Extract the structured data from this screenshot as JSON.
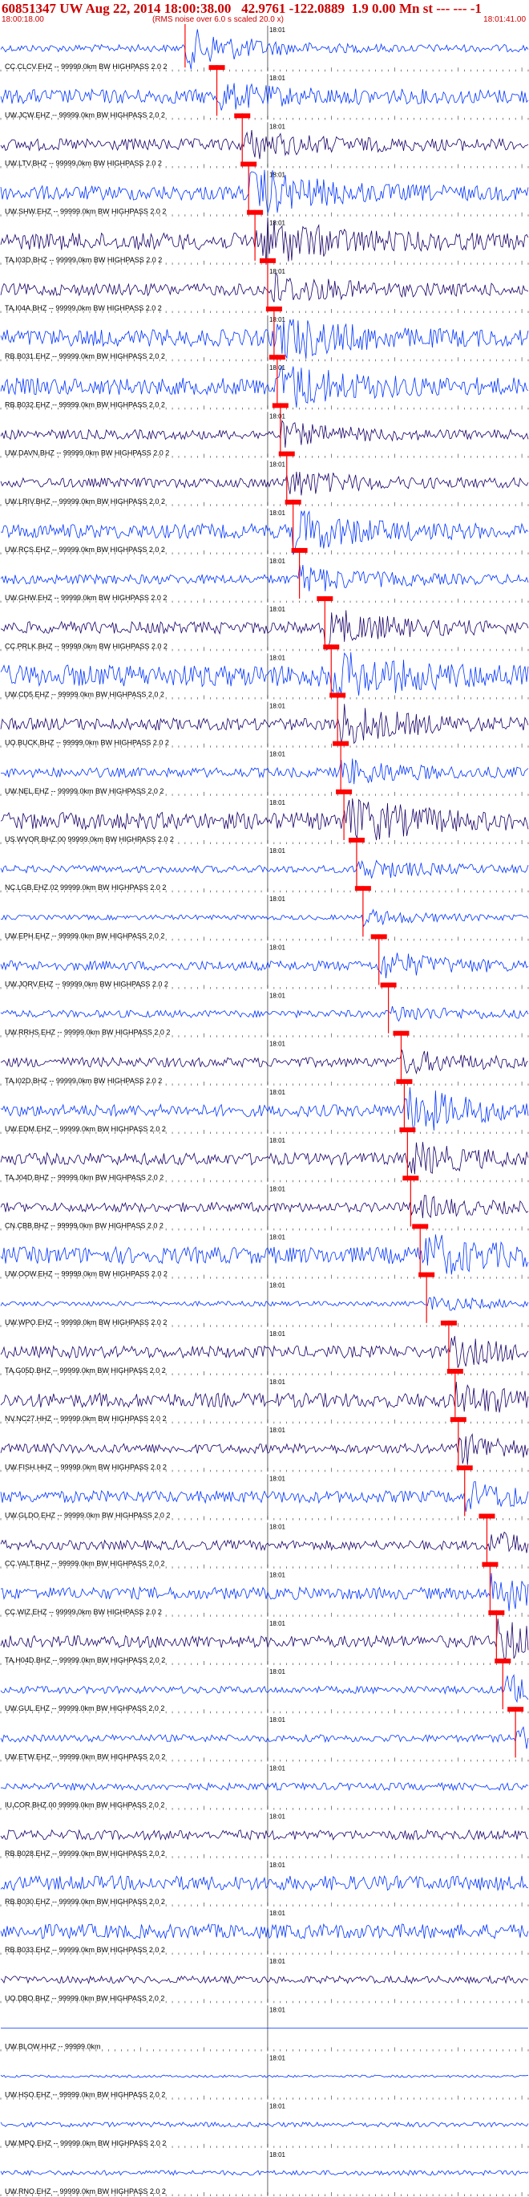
{
  "header": {
    "event_line": "60851347 UW Aug 22, 2014 18:00:38.00   42.9761 -122.0889  1.9 0.00 Mn st --- --- -1",
    "start_time": "18:00:18.00",
    "rms_note": "(RMS noise over 6.0 s scaled 20.0 x)",
    "end_time": "18:01:41.00"
  },
  "chart_data": {
    "type": "seismogram-record-section",
    "time_start": "18:00:18.00",
    "time_end": "18:01:41.00",
    "minute_mark": "18:01",
    "colors": {
      "trace_a": "#0033ff",
      "trace_b": "#1a0066",
      "pick": "#ff0000",
      "text": "#000000"
    },
    "traces": [
      {
        "label": "CC.CLCV.EHZ -- 99999.0km BW  HIGHPASS  2.0  2",
        "pick_s": 29.0,
        "amp": 0.15,
        "event_amp": 0.8,
        "color": "blue"
      },
      {
        "label": "UW.JCW.EHZ -- 99999.0km BW  HIGHPASS  2.0  2",
        "pick_s": 34.0,
        "amp": 0.3,
        "event_amp": 0.4,
        "color": "blue"
      },
      {
        "label": "UW.LTV.BHZ -- 99999.0km BW  HIGHPASS  2.0  2",
        "pick_s": 38.0,
        "amp": 0.25,
        "event_amp": 0.5,
        "color": "dark"
      },
      {
        "label": "UW.SHW.EHZ -- 99999.0km BW  HIGHPASS  2.0  2",
        "pick_s": 39.0,
        "amp": 0.3,
        "event_amp": 1.0,
        "color": "blue"
      },
      {
        "label": "TA.I03D.BHZ -- 99999.0km BW  HIGHPASS  2.0  2",
        "pick_s": 40.0,
        "amp": 0.35,
        "event_amp": 1.0,
        "color": "dark"
      },
      {
        "label": "TA.I04A.BHZ -- 99999.0km BW  HIGHPASS  2.0  2",
        "pick_s": 42.0,
        "amp": 0.25,
        "event_amp": 0.6,
        "color": "dark"
      },
      {
        "label": "RB.B031.EHZ -- 99999.0km BW  HIGHPASS  2.0  2",
        "pick_s": 43.0,
        "amp": 0.35,
        "event_amp": 0.9,
        "color": "blue"
      },
      {
        "label": "RB.B032.EHZ -- 99999.0km BW  HIGHPASS  2.0  2",
        "pick_s": 43.5,
        "amp": 0.35,
        "event_amp": 0.9,
        "color": "blue"
      },
      {
        "label": "UW.DAVN.BHZ -- 99999.0km BW  HIGHPASS  2.0  2",
        "pick_s": 44.0,
        "amp": 0.2,
        "event_amp": 0.4,
        "color": "dark"
      },
      {
        "label": "UW.LRIV.BHZ -- 99999.0km BW  HIGHPASS  2.0  2",
        "pick_s": 45.0,
        "amp": 0.2,
        "event_amp": 0.5,
        "color": "dark"
      },
      {
        "label": "UW.RCS.EHZ -- 99999.0km BW  HIGHPASS  2.0  2",
        "pick_s": 46.0,
        "amp": 0.3,
        "event_amp": 0.8,
        "color": "blue"
      },
      {
        "label": "UW.GHW.EHZ -- 99999.0km BW  HIGHPASS  2.0  2",
        "pick_s": 47.0,
        "amp": 0.2,
        "event_amp": 0.5,
        "color": "blue"
      },
      {
        "label": "CC.PRLK.BHZ -- 99999.0km BW  HIGHPASS  2.0  2",
        "pick_s": 51.0,
        "amp": 0.25,
        "event_amp": 0.7,
        "color": "dark"
      },
      {
        "label": "UW.CD5.EHZ -- 99999.0km BW  HIGHPASS  2.0  2",
        "pick_s": 52.0,
        "amp": 0.45,
        "event_amp": 0.8,
        "color": "blue"
      },
      {
        "label": "UO.BUCK.BHZ -- 99999.0km BW  HIGHPASS  2.0  2",
        "pick_s": 53.0,
        "amp": 0.25,
        "event_amp": 0.8,
        "color": "dark"
      },
      {
        "label": "UW.NEL.EHZ -- 99999.0km BW  HIGHPASS  2.0  2",
        "pick_s": 53.5,
        "amp": 0.2,
        "event_amp": 0.5,
        "color": "blue"
      },
      {
        "label": "US.WVOR.BHZ.00 99999.0km BW  HIGHPASS  2.0  2",
        "pick_s": 54.0,
        "amp": 0.35,
        "event_amp": 0.9,
        "color": "dark"
      },
      {
        "label": "NC.LGB.EHZ.02 99999.0km BW  HIGHPASS  2.0  2",
        "pick_s": 56.0,
        "amp": 0.15,
        "event_amp": 0.4,
        "color": "blue"
      },
      {
        "label": "UW.EPH.EHZ -- 99999.0km BW  HIGHPASS  2.0  2",
        "pick_s": 57.0,
        "amp": 0.1,
        "event_amp": 0.3,
        "color": "blue"
      },
      {
        "label": "UW.JORV.EHZ -- 99999.0km BW  HIGHPASS  2.0  2",
        "pick_s": 59.5,
        "amp": 0.2,
        "event_amp": 0.5,
        "color": "blue"
      },
      {
        "label": "UW.RRHS.EHZ -- 99999.0km BW  HIGHPASS  2.0  2",
        "pick_s": 61.0,
        "amp": 0.15,
        "event_amp": 0.3,
        "color": "blue"
      },
      {
        "label": "TA.I02D.BHZ -- 99999.0km BW  HIGHPASS  2.0  2",
        "pick_s": 63.0,
        "amp": 0.2,
        "event_amp": 0.4,
        "color": "dark"
      },
      {
        "label": "UW.EDM.EHZ -- 99999.0km BW  HIGHPASS  2.0  2",
        "pick_s": 63.5,
        "amp": 0.25,
        "event_amp": 1.0,
        "color": "blue"
      },
      {
        "label": "TA.J04D.BHZ -- 99999.0km BW  HIGHPASS  2.0  2",
        "pick_s": 64.0,
        "amp": 0.25,
        "event_amp": 0.6,
        "color": "dark"
      },
      {
        "label": "CN.CBB.BHZ -- 99999.0km BW  HIGHPASS  2.0  2",
        "pick_s": 64.5,
        "amp": 0.2,
        "event_amp": 0.4,
        "color": "dark"
      },
      {
        "label": "UW.OOW.EHZ -- 99999.0km BW  HIGHPASS  2.0  2",
        "pick_s": 66.0,
        "amp": 0.35,
        "event_amp": 0.8,
        "color": "blue"
      },
      {
        "label": "UW.WPO.EHZ -- 99999.0km BW  HIGHPASS  2.0  2",
        "pick_s": 67.0,
        "amp": 0.1,
        "event_amp": 0.3,
        "color": "blue"
      },
      {
        "label": "TA.G05D.BHZ -- 99999.0km BW  HIGHPASS  2.0  2",
        "pick_s": 70.5,
        "amp": 0.25,
        "event_amp": 0.5,
        "color": "dark"
      },
      {
        "label": "NV.NC27.HHZ -- 99999.0km BW  HIGHPASS  2.0  2",
        "pick_s": 71.5,
        "amp": 0.3,
        "event_amp": 0.5,
        "color": "dark"
      },
      {
        "label": "UW.FISH.HHZ -- 99999.0km BW  HIGHPASS  2.0  2",
        "pick_s": 72.0,
        "amp": 0.2,
        "event_amp": 0.6,
        "color": "dark"
      },
      {
        "label": "UW.GLDO.EHZ -- 99999.0km BW  HIGHPASS  2.0  2",
        "pick_s": 73.0,
        "amp": 0.25,
        "event_amp": 0.5,
        "color": "blue"
      },
      {
        "label": "CC.VALT.BHZ -- 99999.0km BW  HIGHPASS  2.0  2",
        "pick_s": 76.5,
        "amp": 0.2,
        "event_amp": 0.5,
        "color": "dark"
      },
      {
        "label": "CC.WIZ.EHZ -- 99999.0km BW  HIGHPASS  2.0  2",
        "pick_s": 77.0,
        "amp": 0.25,
        "event_amp": 0.7,
        "color": "blue"
      },
      {
        "label": "TA.H04D.BHZ -- 99999.0km BW  HIGHPASS  2.0  2",
        "pick_s": 78.0,
        "amp": 0.25,
        "event_amp": 0.8,
        "color": "dark"
      },
      {
        "label": "UW.GUL.EHZ -- 99999.0km BW  HIGHPASS  2.0  2",
        "pick_s": 79.0,
        "amp": 0.15,
        "event_amp": 0.6,
        "color": "blue"
      },
      {
        "label": "UW.ETW.EHZ -- 99999.0km BW  HIGHPASS  2.0  2",
        "pick_s": 81.0,
        "amp": 0.15,
        "event_amp": 0.4,
        "color": "blue"
      },
      {
        "label": "IU.COR.BHZ.00 99999.0km BW  HIGHPASS  2.0  2",
        "pick_s": null,
        "amp": 0.15,
        "event_amp": 0.0,
        "color": "blue"
      },
      {
        "label": "RB.B028.EHZ -- 99999.0km BW  HIGHPASS  2.0  2",
        "pick_s": null,
        "amp": 0.2,
        "event_amp": 0.0,
        "color": "dark"
      },
      {
        "label": "RB.B030.EHZ -- 99999.0km BW  HIGHPASS  2.0  2",
        "pick_s": null,
        "amp": 0.3,
        "event_amp": 0.0,
        "color": "blue"
      },
      {
        "label": "RB.B033.EHZ -- 99999.0km BW  HIGHPASS  2.0  2",
        "pick_s": null,
        "amp": 0.3,
        "event_amp": 0.0,
        "color": "blue"
      },
      {
        "label": "UO.DBO.BHZ -- 99999.0km BW  HIGHPASS  2.0  2",
        "pick_s": null,
        "amp": 0.15,
        "event_amp": 0.0,
        "color": "dark"
      },
      {
        "label": "UW.BLOW.HHZ -- 99999.0km",
        "pick_s": null,
        "amp": 0.0,
        "event_amp": 0.0,
        "color": "blue"
      },
      {
        "label": "UW.HSO.EHZ -- 99999.0km BW  HIGHPASS  2.0  2",
        "pick_s": null,
        "amp": 0.05,
        "event_amp": 0.0,
        "color": "blue"
      },
      {
        "label": "UW.MPQ.EHZ -- 99999.0km BW  HIGHPASS  2.0  2",
        "pick_s": null,
        "amp": 0.1,
        "event_amp": 0.0,
        "color": "blue"
      },
      {
        "label": "UW.RNO.EHZ -- 99999.0km BW  HIGHPASS  2.0  2",
        "pick_s": null,
        "amp": 0.1,
        "event_amp": 0.0,
        "color": "blue"
      }
    ]
  }
}
